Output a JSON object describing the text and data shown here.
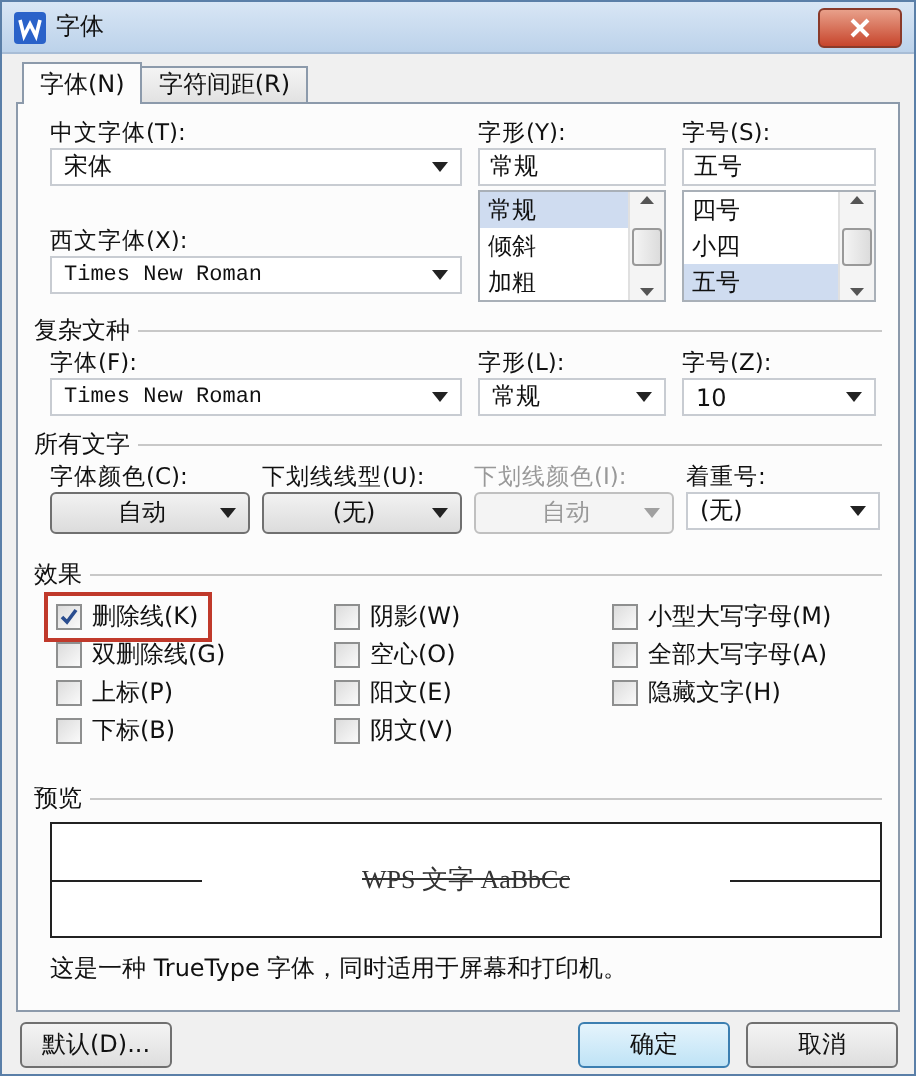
{
  "window": {
    "title": "字体"
  },
  "tabs": [
    {
      "label": "字体(N)",
      "selected": true
    },
    {
      "label": "字符间距(R)",
      "selected": false
    }
  ],
  "font": {
    "chinese_font": {
      "label": "中文字体(T):",
      "value": "宋体"
    },
    "western_font": {
      "label": "西文字体(X):",
      "value": "Times New Roman"
    },
    "style": {
      "label": "字形(Y):",
      "value": "常规",
      "options": [
        {
          "label": "常规",
          "selected": true
        },
        {
          "label": "倾斜",
          "selected": false
        },
        {
          "label": "加粗",
          "selected": false
        }
      ]
    },
    "size": {
      "label": "字号(S):",
      "value": "五号",
      "options": [
        {
          "label": "四号",
          "selected": false
        },
        {
          "label": "小四",
          "selected": false
        },
        {
          "label": "五号",
          "selected": true
        }
      ]
    }
  },
  "complex_script": {
    "heading": "复杂文种",
    "font": {
      "label": "字体(F):",
      "value": "Times New Roman"
    },
    "style": {
      "label": "字形(L):",
      "value": "常规"
    },
    "size": {
      "label": "字号(Z):",
      "value": "10"
    }
  },
  "all_text": {
    "heading": "所有文字",
    "dropdowns": [
      {
        "label": "字体颜色(C):",
        "value": "自动",
        "disabled": false,
        "kind": "button"
      },
      {
        "label": "下划线线型(U):",
        "value": "(无)",
        "disabled": false,
        "kind": "button"
      },
      {
        "label": "下划线颜色(I):",
        "value": "自动",
        "disabled": true,
        "kind": "button"
      },
      {
        "label": "着重号:",
        "value": "(无)",
        "disabled": false,
        "kind": "combo"
      }
    ]
  },
  "effects": {
    "heading": "效果",
    "columns": [
      [
        {
          "label": "删除线(K)",
          "checked": true,
          "highlighted": true
        },
        {
          "label": "双删除线(G)",
          "checked": false,
          "highlighted": false
        },
        {
          "label": "上标(P)",
          "checked": false,
          "highlighted": false
        },
        {
          "label": "下标(B)",
          "checked": false,
          "highlighted": false
        }
      ],
      [
        {
          "label": "阴影(W)",
          "checked": false,
          "highlighted": false
        },
        {
          "label": "空心(O)",
          "checked": false,
          "highlighted": false
        },
        {
          "label": "阳文(E)",
          "checked": false,
          "highlighted": false
        },
        {
          "label": "阴文(V)",
          "checked": false,
          "highlighted": false
        }
      ],
      [
        {
          "label": "小型大写字母(M)",
          "checked": false,
          "highlighted": false
        },
        {
          "label": "全部大写字母(A)",
          "checked": false,
          "highlighted": false
        },
        {
          "label": "隐藏文字(H)",
          "checked": false,
          "highlighted": false
        }
      ]
    ]
  },
  "preview": {
    "heading": "预览",
    "sample": "WPS 文字 AaBbCc",
    "strikethrough": true,
    "description": "这是一种 TrueType 字体，同时适用于屏幕和打印机。"
  },
  "buttons": [
    {
      "label": "默认(D)...",
      "kind": "normal"
    },
    {
      "label": "确定",
      "kind": "primary"
    },
    {
      "label": "取消",
      "kind": "normal"
    }
  ]
}
